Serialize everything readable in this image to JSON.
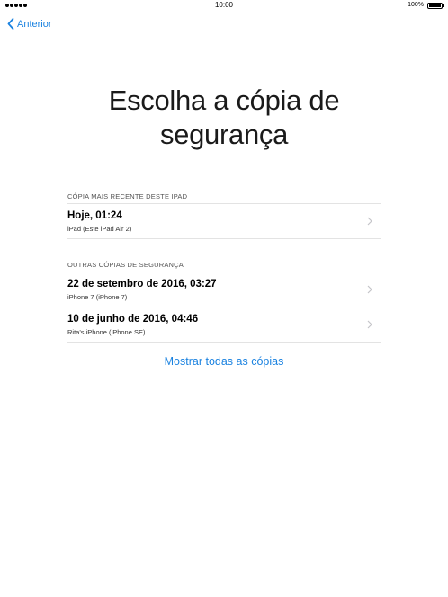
{
  "status_bar": {
    "time": "10:00",
    "battery": "100%"
  },
  "nav": {
    "back_label": "Anterior"
  },
  "title": {
    "line1": "Escolha a cópia de",
    "line2": "segurança"
  },
  "recent": {
    "header": "CÓPIA MAIS RECENTE DESTE IPAD",
    "items": [
      {
        "title": "Hoje, 01:24",
        "subtitle": "iPad (Este iPad Air 2)"
      }
    ]
  },
  "others": {
    "header": "OUTRAS CÓPIAS DE SEGURANÇA",
    "items": [
      {
        "title": "22 de setembro de 2016, 03:27",
        "subtitle": "iPhone 7 (iPhone 7)"
      },
      {
        "title": "10 de junho de 2016, 04:46",
        "subtitle": "Rita's iPhone (iPhone SE)"
      }
    ]
  },
  "show_all_label": "Mostrar todas as cópias",
  "colors": {
    "accent": "#1a82e0",
    "separator": "#e3e3e3"
  },
  "icons": {
    "back": "chevron-left-icon",
    "row": "chevron-right-icon"
  }
}
